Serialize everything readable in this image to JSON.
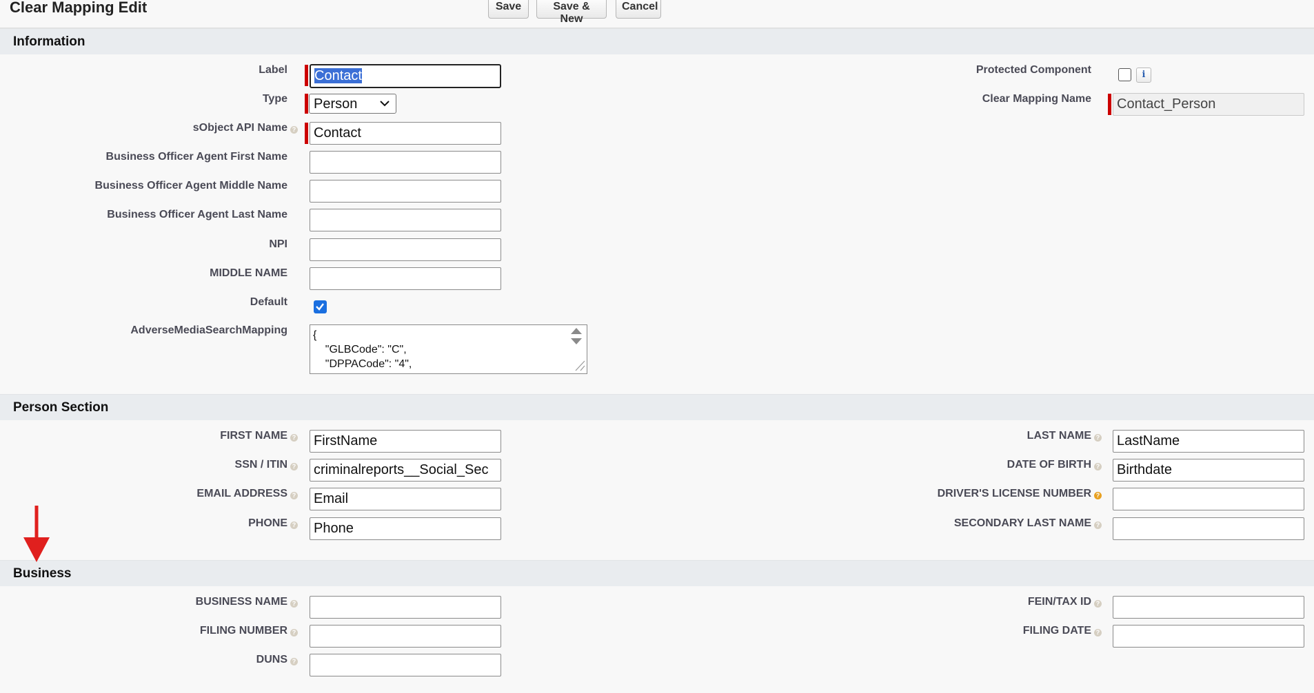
{
  "header": {
    "title": "Clear Mapping Edit",
    "buttons": {
      "save": "Save",
      "save_new": "Save & New",
      "cancel": "Cancel"
    }
  },
  "sections": {
    "information": "Information",
    "person": "Person Section",
    "business": "Business"
  },
  "information": {
    "label": {
      "label": "Label",
      "value_selected": "Contact"
    },
    "type": {
      "label": "Type",
      "value": "Person"
    },
    "sobject_api_name": {
      "label": "sObject API Name",
      "value": "Contact"
    },
    "bo_first": {
      "label": "Business Officer Agent First Name",
      "value": ""
    },
    "bo_middle": {
      "label": "Business Officer Agent Middle Name",
      "value": ""
    },
    "bo_last": {
      "label": "Business Officer Agent Last Name",
      "value": ""
    },
    "npi": {
      "label": "NPI",
      "value": ""
    },
    "middle_name": {
      "label": "MIDDLE NAME",
      "value": ""
    },
    "default": {
      "label": "Default",
      "checked": true
    },
    "adverse": {
      "label": "AdverseMediaSearchMapping",
      "value": "{\n    \"GLBCode\": \"C\",\n    \"DPPACode\": \"4\","
    },
    "protected": {
      "label": "Protected Component",
      "checked": false,
      "info_glyph": "i"
    },
    "clear_mapping_name": {
      "label": "Clear Mapping Name",
      "value": "Contact_Person"
    }
  },
  "person": {
    "first_name": {
      "label": "FIRST NAME",
      "value": "FirstName"
    },
    "ssn": {
      "label": "SSN / ITIN",
      "value": "criminalreports__Social_Sec"
    },
    "email": {
      "label": "EMAIL ADDRESS",
      "value": "Email"
    },
    "phone": {
      "label": "PHONE",
      "value": "Phone"
    },
    "last_name": {
      "label": "LAST NAME",
      "value": "LastName"
    },
    "dob": {
      "label": "DATE OF BIRTH",
      "value": "Birthdate"
    },
    "dl": {
      "label": "DRIVER'S LICENSE NUMBER",
      "value": ""
    },
    "secondary_last": {
      "label": "SECONDARY LAST NAME",
      "value": ""
    }
  },
  "business": {
    "business_name": {
      "label": "BUSINESS NAME",
      "value": ""
    },
    "filing_number": {
      "label": "FILING NUMBER",
      "value": ""
    },
    "duns": {
      "label": "DUNS",
      "value": ""
    },
    "fein": {
      "label": "FEIN/TAX ID",
      "value": ""
    },
    "filing_date": {
      "label": "FILING DATE",
      "value": ""
    }
  },
  "icons": {
    "help": "help-icon",
    "help_warning": "help-warning-icon",
    "info": "info-icon",
    "chevron": "chevron-down-icon",
    "annotation_arrow": "red-down-arrow-icon"
  },
  "colors": {
    "required": "#cc0000",
    "section_bg": "#e9ecef",
    "checkbox_checked": "#1a6fe0",
    "selection": "#3b6fd6",
    "annotation": "#e0201e"
  }
}
